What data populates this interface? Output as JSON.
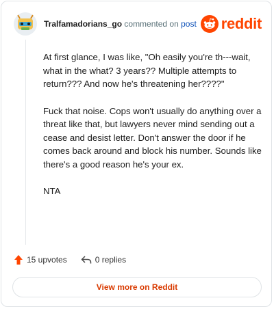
{
  "comment": {
    "username": "Tralfamadorians_go",
    "action_text": "commented on",
    "post_link": "post",
    "paragraphs": [
      "At first glance, I was like, \"Oh easily you're th---wait, what in the what? 3 years?? Multiple attempts to return??? And now he's threatening her????\"",
      "Fuck that noise. Cops won't usually do anything over a threat like that, but lawyers never mind sending out a cease and desist letter. Don't answer the door if he comes back around and block his number. Sounds like there's a good reason he's your ex.",
      "NTA"
    ]
  },
  "brand": {
    "name": "reddit",
    "color": "#ff4500"
  },
  "footer": {
    "upvotes": "15 upvotes",
    "replies": "0 replies",
    "upvote_icon": "upvote-arrow-icon",
    "reply_icon": "reply-arrow-icon"
  },
  "view_more": {
    "label": "View more on Reddit"
  },
  "colors": {
    "accent": "#d93a00",
    "link": "#0a4fb8",
    "muted": "#576f76"
  }
}
